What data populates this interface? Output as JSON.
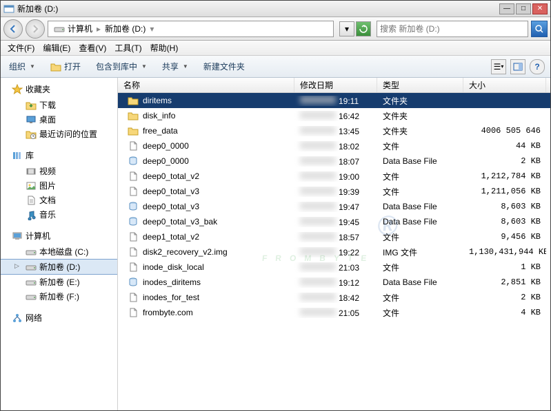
{
  "window": {
    "title": "新加卷 (D:)"
  },
  "nav": {
    "breadcrumb": {
      "root": "计算机",
      "sep": "▸",
      "current": "新加卷 (D:)"
    },
    "search_placeholder": "搜索 新加卷 (D:)"
  },
  "menu": {
    "items": [
      {
        "label": "文件(F)"
      },
      {
        "label": "编辑(E)"
      },
      {
        "label": "查看(V)"
      },
      {
        "label": "工具(T)"
      },
      {
        "label": "帮助(H)"
      }
    ]
  },
  "toolbar": {
    "organize": "组织",
    "open": "打开",
    "include": "包含到库中",
    "share": "共享",
    "newfolder": "新建文件夹"
  },
  "sidebar": {
    "favorites": {
      "label": "收藏夹",
      "items": [
        {
          "label": "下载",
          "icon": "download"
        },
        {
          "label": "桌面",
          "icon": "desktop"
        },
        {
          "label": "最近访问的位置",
          "icon": "recent"
        }
      ]
    },
    "libraries": {
      "label": "库",
      "items": [
        {
          "label": "视频",
          "icon": "video"
        },
        {
          "label": "图片",
          "icon": "picture"
        },
        {
          "label": "文档",
          "icon": "document"
        },
        {
          "label": "音乐",
          "icon": "music"
        }
      ]
    },
    "computer": {
      "label": "计算机",
      "items": [
        {
          "label": "本地磁盘 (C:)",
          "icon": "drive"
        },
        {
          "label": "新加卷 (D:)",
          "icon": "drive",
          "selected": true
        },
        {
          "label": "新加卷 (E:)",
          "icon": "drive"
        },
        {
          "label": "新加卷 (F:)",
          "icon": "drive"
        }
      ]
    },
    "network": {
      "label": "网络"
    }
  },
  "columns": {
    "name": "名称",
    "date": "修改日期",
    "type": "类型",
    "size": "大小"
  },
  "files": [
    {
      "name": "diritems",
      "icon": "folder",
      "time": "19:11",
      "type": "文件夹",
      "size": "",
      "selected": true
    },
    {
      "name": "disk_info",
      "icon": "folder",
      "time": "16:42",
      "type": "文件夹",
      "size": ""
    },
    {
      "name": "free_data",
      "icon": "folder",
      "time": "13:45",
      "type": "文件夹",
      "size": "4006 505 646"
    },
    {
      "name": "deep0_0000",
      "icon": "file",
      "time": "18:02",
      "type": "文件",
      "size": "44 KB"
    },
    {
      "name": "deep0_0000",
      "icon": "db",
      "time": "18:07",
      "type": "Data Base File",
      "size": "2 KB"
    },
    {
      "name": "deep0_total_v2",
      "icon": "file",
      "time": "19:00",
      "type": "文件",
      "size": "1,212,784 KB"
    },
    {
      "name": "deep0_total_v3",
      "icon": "file",
      "time": "19:39",
      "type": "文件",
      "size": "1,211,056 KB"
    },
    {
      "name": "deep0_total_v3",
      "icon": "db",
      "time": "19:47",
      "type": "Data Base File",
      "size": "8,603 KB"
    },
    {
      "name": "deep0_total_v3_bak",
      "icon": "db",
      "time": "19:45",
      "type": "Data Base File",
      "size": "8,603 KB"
    },
    {
      "name": "deep1_total_v2",
      "icon": "file",
      "time": "18:57",
      "type": "文件",
      "size": "9,456 KB"
    },
    {
      "name": "disk2_recovery_v2.img",
      "icon": "file",
      "time": "19:22",
      "type": "IMG 文件",
      "size": "1,130,431,944 KB"
    },
    {
      "name": "inode_disk_local",
      "icon": "file",
      "time": "21:03",
      "type": "文件",
      "size": "1 KB"
    },
    {
      "name": "inodes_diritems",
      "icon": "db",
      "time": "19:12",
      "type": "Data Base File",
      "size": "2,851 KB"
    },
    {
      "name": "inodes_for_test",
      "icon": "file",
      "time": "18:42",
      "type": "文件",
      "size": "2 KB"
    },
    {
      "name": "frombyte.com",
      "icon": "file",
      "time": "21:05",
      "type": "文件",
      "size": "4 KB"
    }
  ],
  "watermark": {
    "text": "FROMBYTE",
    "reg": "®"
  }
}
